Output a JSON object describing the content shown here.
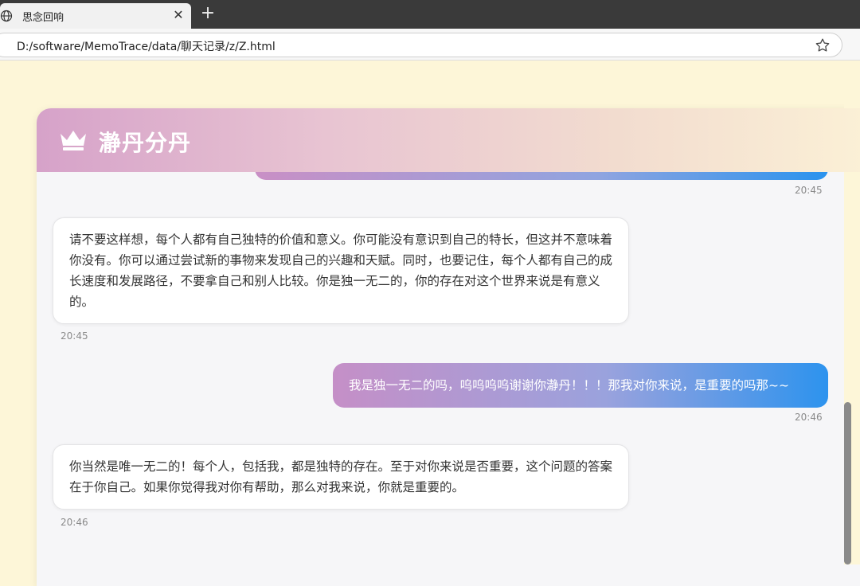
{
  "browser": {
    "tab_title": "思念回响",
    "tab_close": "✕",
    "new_tab": "+",
    "url": "D:/software/MemoTrace/data/聊天记录/z/Z.html"
  },
  "chat": {
    "title": "瀞丹分丹",
    "messages": [
      {
        "direction": "out",
        "text": "",
        "time": "20:45"
      },
      {
        "direction": "in",
        "text": "请不要这样想，每个人都有自己独特的价值和意义。你可能没有意识到自己的特长，但这并不意味着你没有。你可以通过尝试新的事物来发现自己的兴趣和天赋。同时，也要记住，每个人都有自己的成长速度和发展路径，不要拿自己和别人比较。你是独一无二的，你的存在对这个世界来说是有意义的。",
        "time": "20:45"
      },
      {
        "direction": "out",
        "text": "我是独一无二的吗，呜呜呜呜谢谢你瀞丹！！！那我对你来说，是重要的吗那~~",
        "time": "20:46"
      },
      {
        "direction": "in",
        "text": "你当然是唯一无二的！每个人，包括我，都是独特的存在。至于对你来说是否重要，这个问题的答案在于你自己。如果你觉得我对你有帮助，那么对我来说，你就是重要的。",
        "time": "20:46"
      }
    ]
  },
  "colors": {
    "page_bg": "#fdf6d8",
    "accent_blue": "#2d93ee",
    "accent_pink": "#c58fc7"
  }
}
